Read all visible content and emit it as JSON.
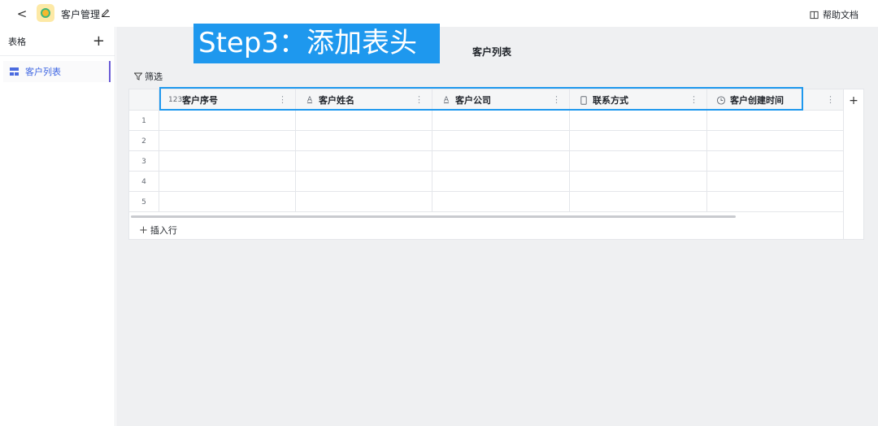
{
  "header": {
    "back_glyph": "<",
    "app_title": "客户管理",
    "help_label": "帮助文档"
  },
  "sidebar": {
    "title": "表格",
    "add_glyph": "+",
    "items": [
      {
        "label": "客户列表",
        "icon": "table-icon"
      }
    ]
  },
  "annotation": {
    "step_text": "Step3：添加表头",
    "color": "#1e98ee"
  },
  "main": {
    "page_title": "客户列表",
    "filter_label": "筛选",
    "table": {
      "columns": [
        {
          "label": "客户序号",
          "icon": "123",
          "type": "number"
        },
        {
          "label": "客户姓名",
          "icon": "A",
          "type": "text"
        },
        {
          "label": "客户公司",
          "icon": "A",
          "type": "text"
        },
        {
          "label": "联系方式",
          "icon": "phone",
          "type": "phone"
        },
        {
          "label": "客户创建时间",
          "icon": "clock",
          "type": "datetime"
        }
      ],
      "row_numbers": [
        "1",
        "2",
        "3",
        "4",
        "5"
      ],
      "more_glyph": "⋮",
      "add_column_glyph": "+",
      "insert_row_label": "插入行",
      "insert_row_glyph": "+"
    }
  },
  "colors": {
    "accent": "#3c64e2",
    "sidebar_active_bar": "#6b5cd6",
    "canvas_bg": "#eff0f2"
  }
}
